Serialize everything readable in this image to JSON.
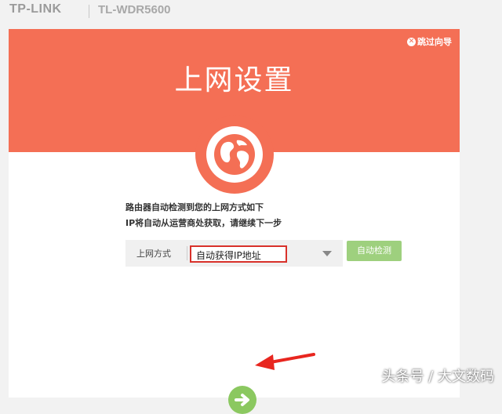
{
  "header": {
    "brand": "TP-LINK",
    "model": "TL-WDR5600"
  },
  "wizard": {
    "skip_label": "跳过向导",
    "title": "上网设置",
    "info_line1": "路由器自动检测到您的上网方式如下",
    "info_line2": "IP将自动从运营商处获取，请继续下一步",
    "field_label": "上网方式",
    "selected_value": "自动获得IP地址",
    "detect_button": "自动检测",
    "next_button_icon": "arrow-right-icon",
    "globe_icon": "globe-icon"
  },
  "colors": {
    "hero": "#f46f55",
    "detect": "#9ed07e",
    "next": "#8bc860",
    "highlight": "#d8312a"
  },
  "watermark": "头条号 / 大文数码"
}
